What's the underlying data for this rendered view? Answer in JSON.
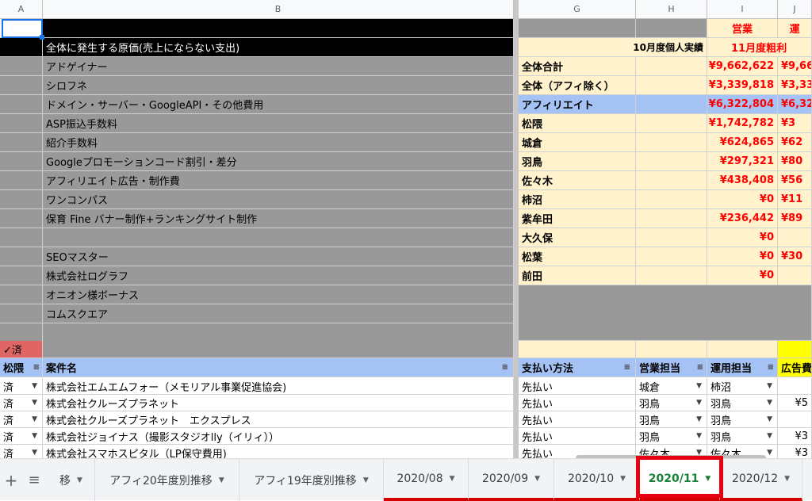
{
  "columns": {
    "a": "A",
    "b": "B",
    "g": "G",
    "h": "H",
    "i": "I",
    "j": "J"
  },
  "left_rows": [
    "",
    "全体に発生する原価(売上にならない支出)",
    "アドゲイナー",
    "シロフネ",
    "ドメイン・サーバー・GoogleAPI・その他費用",
    "ASP振込手数料",
    "紹介手数料",
    "Googleプロモーションコード割引・差分",
    "アフィリエイト広告・制作費",
    "ワンコンパス",
    "保育 Fine バナー制作+ランキングサイト制作",
    "",
    "SEOマスター",
    "株式会社ログラフ",
    "オニオン様ボーナス",
    "コムスクエア",
    "",
    ""
  ],
  "summary": {
    "header_eigyo": "営業",
    "header_unyo": "運",
    "prev_month_label": "10月度個人実績",
    "this_month_label": "11月度粗利",
    "rows": [
      {
        "name": "全体合計",
        "i": "¥9,662,622",
        "j": "¥9,66"
      },
      {
        "name": "全体（アフィ除く）",
        "i": "¥3,339,818",
        "j": "¥3,33"
      },
      {
        "name": "アフィリエイト",
        "i": "¥6,322,804",
        "j": "¥6,32"
      },
      {
        "name": "松隈",
        "i": "¥1,742,782",
        "j": "¥3"
      },
      {
        "name": "城倉",
        "i": "¥624,865",
        "j": "¥62"
      },
      {
        "name": "羽鳥",
        "i": "¥297,321",
        "j": "¥80"
      },
      {
        "name": "佐々木",
        "i": "¥438,408",
        "j": "¥56"
      },
      {
        "name": "柿沼",
        "i": "¥0",
        "j": "¥11"
      },
      {
        "name": "紫牟田",
        "i": "¥236,442",
        "j": "¥89"
      },
      {
        "name": "大久保",
        "i": "¥0",
        "j": ""
      },
      {
        "name": "松葉",
        "i": "¥0",
        "j": "¥30"
      },
      {
        "name": "前田",
        "i": "¥0",
        "j": ""
      }
    ]
  },
  "check_label": "✓済",
  "headers": {
    "a": "松隈",
    "b": "案件名",
    "g": "支払い方法",
    "h": "営業担当",
    "i": "運用担当",
    "j": "広告費"
  },
  "data_rows": [
    {
      "a": "済",
      "b": "株式会社エムエムフォー（メモリアル事業促進協会)",
      "g": "先払い",
      "h": "城倉",
      "i": "柿沼",
      "j": ""
    },
    {
      "a": "済",
      "b": "株式会社クルーズプラネット",
      "g": "先払い",
      "h": "羽鳥",
      "i": "羽鳥",
      "j": "¥5"
    },
    {
      "a": "済",
      "b": "株式会社クルーズプラネット　エクスプレス",
      "g": "先払い",
      "h": "羽鳥",
      "i": "羽鳥",
      "j": ""
    },
    {
      "a": "済",
      "b": "株式会社ジョイナス（撮影スタジオlly（イリィ））",
      "g": "先払い",
      "h": "羽鳥",
      "i": "羽鳥",
      "j": "¥3"
    },
    {
      "a": "済",
      "b": "株式会社スマホスピタル（LP保守費用)",
      "g": "先払い",
      "h": "佐々木",
      "i": "佐々木",
      "j": "¥3"
    }
  ],
  "tabs": [
    "移",
    "アフィ20年度別推移",
    "アフィ19年度別推移",
    "2020/08",
    "2020/09",
    "2020/10",
    "2020/11",
    "2020/12"
  ],
  "icons": {
    "add": "plus-icon",
    "list": "menu-icon"
  },
  "colors": {
    "active_tab": "#188038",
    "highlight": "#e60012",
    "header_blue": "#a4c2f4",
    "cream": "#fff2cc",
    "check_cell": "#e06666"
  }
}
